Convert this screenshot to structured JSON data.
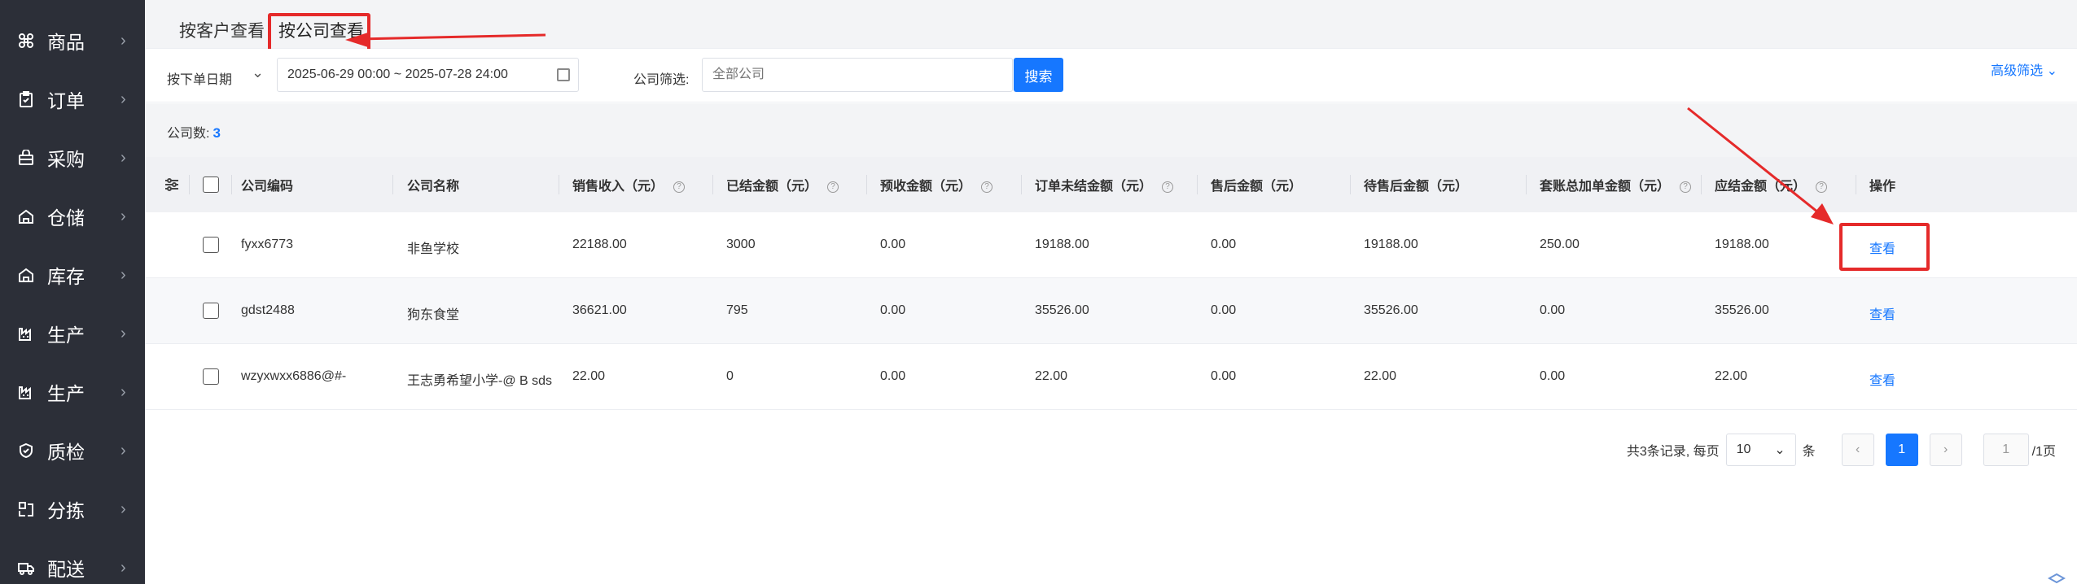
{
  "sidebar": {
    "items": [
      {
        "label": "商品",
        "icon": "command-icon"
      },
      {
        "label": "订单",
        "icon": "clipboard-icon"
      },
      {
        "label": "采购",
        "icon": "basket-icon"
      },
      {
        "label": "仓储",
        "icon": "house-icon"
      },
      {
        "label": "库存",
        "icon": "house-icon"
      },
      {
        "label": "生产",
        "icon": "factory-icon"
      },
      {
        "label": "生产",
        "icon": "factory-icon"
      },
      {
        "label": "质检",
        "icon": "shield-icon"
      },
      {
        "label": "分拣",
        "icon": "sort-icon"
      },
      {
        "label": "配送",
        "icon": "truck-icon"
      }
    ]
  },
  "tabs": {
    "customer": "按客户查看",
    "company": "按公司查看"
  },
  "filters": {
    "date_type": "按下单日期",
    "date_range": "2025-06-29 00:00 ~ 2025-07-28 24:00",
    "company_label": "公司筛选:",
    "company_placeholder": "全部公司",
    "search": "搜索",
    "advanced": "高级筛选"
  },
  "summary": {
    "label": "公司数:",
    "count": "3"
  },
  "table": {
    "headers": {
      "code": "公司编码",
      "name": "公司名称",
      "sales": "销售收入（元）",
      "settled": "已结金额（元）",
      "prepaid": "预收金额（元）",
      "unsettled": "订单未结金额（元）",
      "after_sales": "售后金额（元）",
      "pending_after_sales": "待售后金额（元）",
      "extra_orders": "套账总加单金额（元）",
      "receivable": "应结金额（元）",
      "operation": "操作"
    },
    "rows": [
      {
        "code": "fyxx6773",
        "name": "非鱼学校",
        "sales": "22188.00",
        "settled": "3000",
        "prepaid": "0.00",
        "unsettled": "19188.00",
        "after_sales": "0.00",
        "pending_after_sales": "19188.00",
        "extra_orders": "250.00",
        "receivable": "19188.00",
        "action": "查看"
      },
      {
        "code": "gdst2488",
        "name": "狗东食堂",
        "sales": "36621.00",
        "settled": "795",
        "prepaid": "0.00",
        "unsettled": "35526.00",
        "after_sales": "0.00",
        "pending_after_sales": "35526.00",
        "extra_orders": "0.00",
        "receivable": "35526.00",
        "action": "查看"
      },
      {
        "code": "wzyxwxx6886@#-",
        "name": "王志勇希望小学-@ B sds",
        "sales": "22.00",
        "settled": "0",
        "prepaid": "0.00",
        "unsettled": "22.00",
        "after_sales": "0.00",
        "pending_after_sales": "22.00",
        "extra_orders": "0.00",
        "receivable": "22.00",
        "action": "查看"
      }
    ]
  },
  "pagination": {
    "summary": "共3条记录, 每页",
    "page_size": "10",
    "unit": "条",
    "prev": "‹",
    "current": "1",
    "next": "›",
    "jump_value": "1",
    "total_pages": "/1页"
  },
  "colors": {
    "accent": "#1677ff",
    "sidebar_bg": "#2c2f38",
    "annotation": "#e52a2a"
  }
}
